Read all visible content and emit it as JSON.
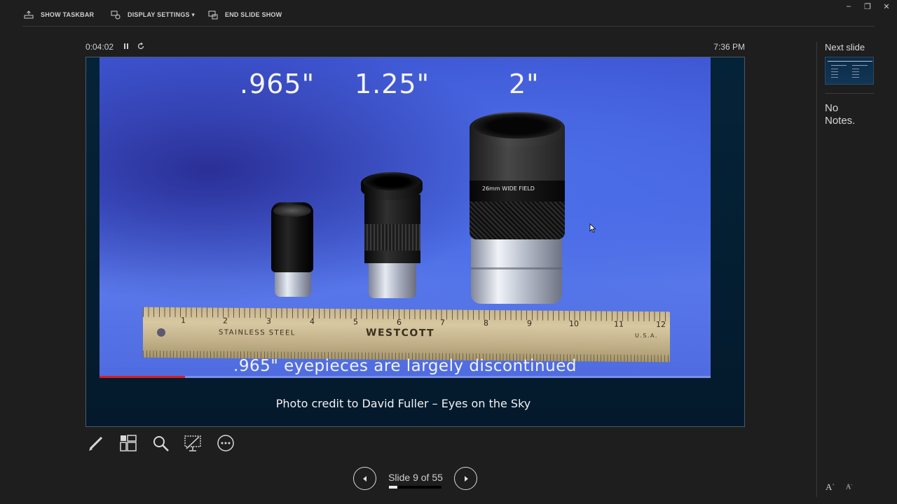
{
  "toolbar": {
    "show_taskbar": "SHOW TASKBAR",
    "display_settings": "DISPLAY SETTINGS ▾",
    "end_slide_show": "END SLIDE SHOW"
  },
  "window": {
    "minimize": "–",
    "restore": "❐",
    "close": "✕"
  },
  "status": {
    "timer": "0:04:02",
    "clock": "7:36 PM"
  },
  "slide": {
    "size_labels": [
      ".965\"",
      "1.25\"",
      "2\""
    ],
    "eyepiece_label": "26mm  WIDE FIELD",
    "ruler": {
      "numbers": [
        "1",
        "2",
        "3",
        "4",
        "5",
        "6",
        "7",
        "8",
        "9",
        "10",
        "11",
        "12"
      ],
      "text_stainless": "STAINLESS STEEL",
      "text_brand": "WESTCOTT",
      "text_usa": "U.S.A."
    },
    "video_caption": ".965\" eyepieces are largely discontinued",
    "video_progress": 0.14,
    "photo_credit": "Photo credit to David Fuller – Eyes on the Sky"
  },
  "navigation": {
    "slide_counter": "Slide 9 of 55",
    "current_slide": 9,
    "total_slides": 55
  },
  "panel": {
    "next_slide_label": "Next slide",
    "notes": "No Notes."
  },
  "font_controls": {
    "increase": "A",
    "decrease": "A"
  }
}
